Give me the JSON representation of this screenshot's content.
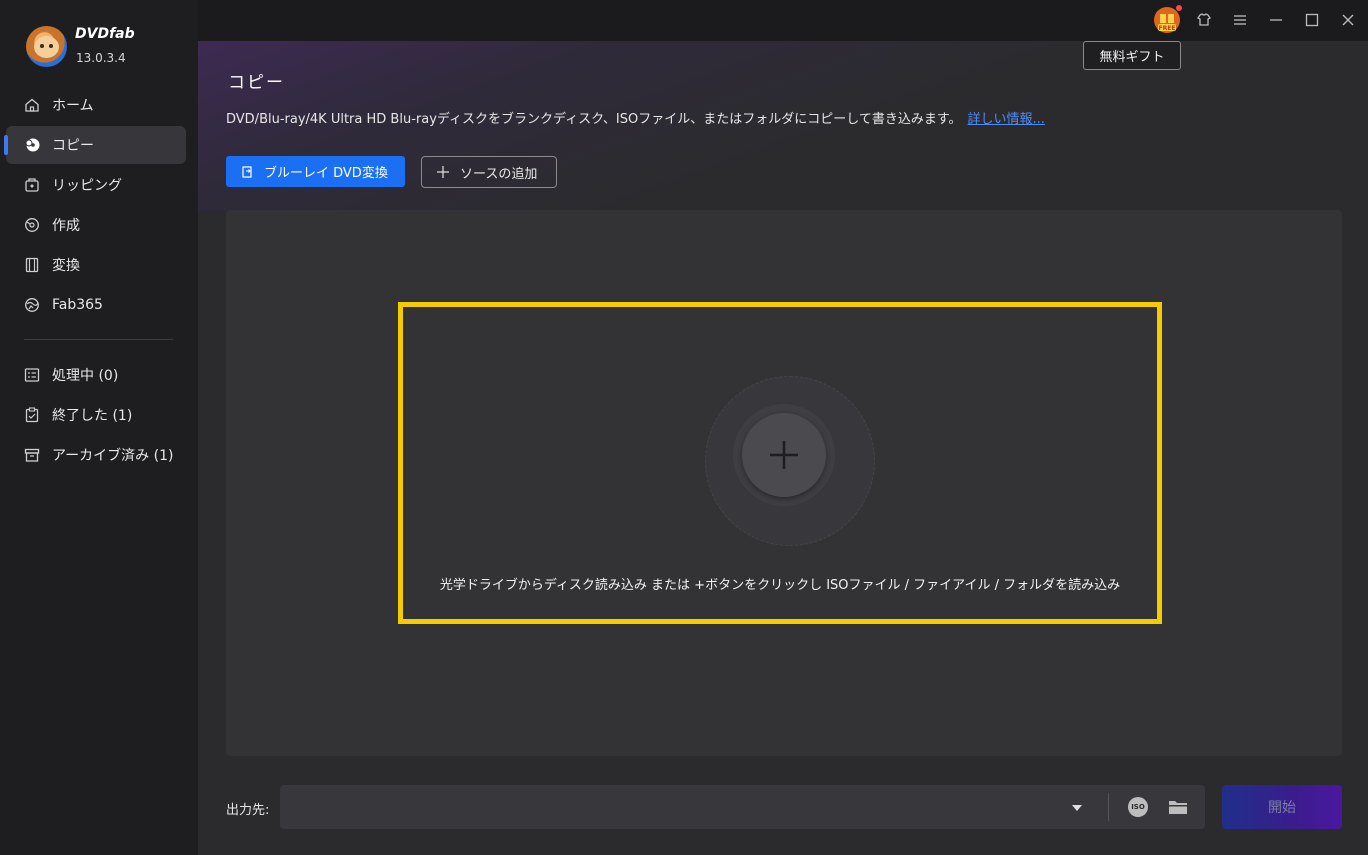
{
  "app": {
    "brand": "DVDfab",
    "version": "13.0.3.4"
  },
  "sidebar": {
    "items": [
      {
        "label": "ホーム",
        "icon": "home-icon"
      },
      {
        "label": "コピー",
        "icon": "copy-disc-icon",
        "active": true
      },
      {
        "label": "リッピング",
        "icon": "ripper-icon"
      },
      {
        "label": "作成",
        "icon": "creator-icon"
      },
      {
        "label": "変換",
        "icon": "converter-icon"
      },
      {
        "label": "Fab365",
        "icon": "fab365-icon"
      }
    ],
    "queue": [
      {
        "label": "処理中 (0)",
        "icon": "processing-list-icon"
      },
      {
        "label": "終了した (1)",
        "icon": "finished-clipboard-icon"
      },
      {
        "label": "アーカイブ済み (1)",
        "icon": "archive-box-icon"
      }
    ]
  },
  "titlebar": {
    "gift_badge": "FREE",
    "tooltip": "無料ギフト",
    "icons": [
      "gift-free-icon",
      "shirt-skin-icon",
      "menu-icon",
      "minimize-icon",
      "maximize-icon",
      "close-icon"
    ]
  },
  "main": {
    "title": "コピー",
    "description": "DVD/Blu-ray/4K Ultra HD Blu-rayディスクをブランクディスク、ISOファイル、またはフォルダにコピーして書き込みます。",
    "learn_more": "詳しい情報...",
    "primary_button": "ブルーレイ DVD変換",
    "add_source_button": "ソースの追加",
    "drop_hint": "光学ドライブからディスク読み込み または +ボタンをクリックし ISOファイル / ファイアイル / フォルダを読み込み",
    "highlight_color": "#f5cc00"
  },
  "bottom": {
    "output_label": "出力先:",
    "output_value": "",
    "iso_label": "ISO",
    "start_button": "開始"
  },
  "colors": {
    "accent": "#1a6ff2",
    "sidebar_bg": "#1e1e21",
    "main_bg": "#2b2b2e"
  }
}
